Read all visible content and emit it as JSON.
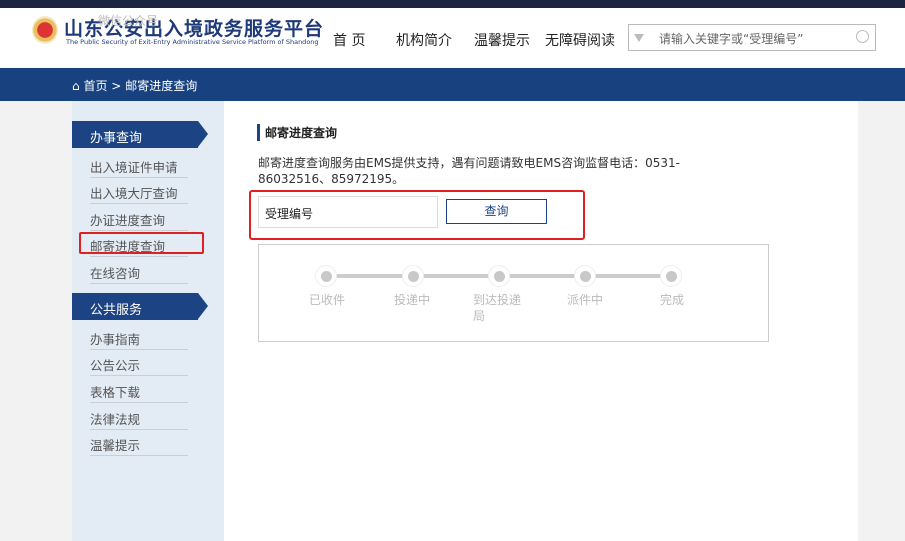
{
  "header": {
    "title": "山东公安出入境政务服务平台",
    "subtitle": "The Public Security of Exit-Entry Administrative Service Platform of Shandong",
    "watermark": "微信公众号",
    "nav": [
      "首 页",
      "机构简介",
      "温馨提示",
      "无障碍阅读"
    ],
    "search_placeholder": "请输入关键字或“受理编号”"
  },
  "breadcrumb": {
    "home": "首页",
    "sep": ">",
    "current": "邮寄进度查询"
  },
  "sidebar": {
    "sections": [
      {
        "title": "办事查询",
        "items": [
          "出入境证件申请",
          "出入境大厅查询",
          "办证进度查询",
          "邮寄进度查询",
          "在线咨询"
        ]
      },
      {
        "title": "公共服务",
        "items": [
          "办事指南",
          "公告公示",
          "表格下载",
          "法律法规",
          "温馨提示"
        ]
      }
    ],
    "selected": "邮寄进度查询"
  },
  "main": {
    "title": "邮寄进度查询",
    "description": "邮寄进度查询服务由EMS提供支持，遇有问题请致电EMS咨询监督电话：0531-86032516、85972195。",
    "input_value": "受理编号",
    "query_label": "查询",
    "steps": [
      "已收件",
      "投递中",
      "到达投递局",
      "派件中",
      "完成"
    ]
  },
  "colors": {
    "primary": "#1c4383",
    "highlight": "#e02020"
  }
}
